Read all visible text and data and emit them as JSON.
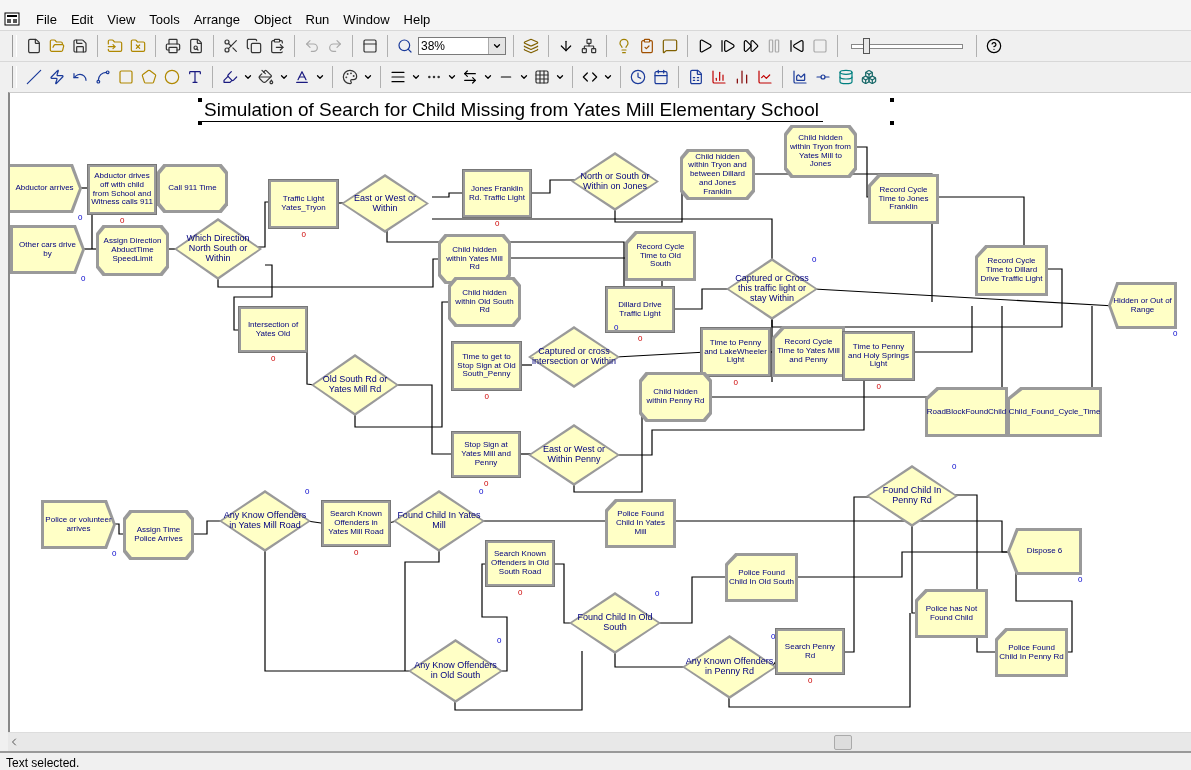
{
  "menu": [
    "File",
    "Edit",
    "View",
    "Tools",
    "Arrange",
    "Object",
    "Run",
    "Window",
    "Help"
  ],
  "zoom": {
    "value": "38%"
  },
  "speed_slider": {
    "level": 0.1
  },
  "diagram": {
    "title": "Simulation of Search for Child Missing from Yates Mill Elementary School",
    "nodes": [
      {
        "kind": "create",
        "label": "Abductor arrives",
        "counter": "0"
      },
      {
        "kind": "process",
        "label": "Abductor drives off with child from School and Witness calls 911",
        "counter": "0"
      },
      {
        "kind": "assign",
        "label": "Call 911 Time"
      },
      {
        "kind": "create",
        "label": "Other cars drive by",
        "counter": "0"
      },
      {
        "kind": "assign",
        "label": "Assign Direction AbductTime SpeedLimit"
      },
      {
        "kind": "decide",
        "label": "Which Direction North South or Within"
      },
      {
        "kind": "process",
        "label": "Traffic Light Yates_Tryon",
        "counter": "0"
      },
      {
        "kind": "decide",
        "label": "East or West or Within"
      },
      {
        "kind": "process",
        "label": "Jones Franklin Rd. Traffic Light",
        "counter": "0"
      },
      {
        "kind": "decide",
        "label": "North or South or Within on Jones"
      },
      {
        "kind": "assign",
        "label": "Child hidden within Tryon and between Dillard and Jones Franklin"
      },
      {
        "kind": "assign",
        "label": "Child hidden within Tryon from Yates Mill to Jones"
      },
      {
        "kind": "record",
        "label": "Record Cycle Time to Jones Franklin"
      },
      {
        "kind": "assign",
        "label": "Child hidden within Yates Mill Rd"
      },
      {
        "kind": "record",
        "label": "Record Cycle Time to Old South"
      },
      {
        "kind": "assign",
        "label": "Child hidden within Old South Rd"
      },
      {
        "kind": "process",
        "label": "Dillard Drive Traffic Light",
        "counter": "0"
      },
      {
        "kind": "decide",
        "label": "Captured or Cross this traffic light or stay Within",
        "counter": "0"
      },
      {
        "kind": "record",
        "label": "Record Cycle Time to Dillard Drive Traffic Light"
      },
      {
        "kind": "dispose",
        "label": "Hidden or Out of Range",
        "counter": "0"
      },
      {
        "kind": "process",
        "label": "Intersection of Yates Old",
        "counter": "0"
      },
      {
        "kind": "decide",
        "label": "Old South Rd or Yates Mill Rd"
      },
      {
        "kind": "process",
        "label": "Time to get to Stop Sign at Old South_Penny",
        "counter": "0"
      },
      {
        "kind": "decide",
        "label": "Captured or cross intersection or Within",
        "counter": "0"
      },
      {
        "kind": "process",
        "label": "Time to Penny and LakeWheeler Light",
        "counter": "0"
      },
      {
        "kind": "record",
        "label": "Record Cycle Time to Yates Mill and Penny"
      },
      {
        "kind": "process",
        "label": "Time to Penny and Holy Springs Light",
        "counter": "0"
      },
      {
        "kind": "assign",
        "label": "Child hidden within Penny Rd"
      },
      {
        "kind": "record",
        "label": "RoadBlockFoundChild"
      },
      {
        "kind": "record",
        "label": "Child_Found_Cycle_Time"
      },
      {
        "kind": "process",
        "label": "Stop Sign at Yates Mill and Penny",
        "counter": "0"
      },
      {
        "kind": "decide",
        "label": "East or West or Within Penny"
      },
      {
        "kind": "create",
        "label": "Police or volunteer arrives",
        "counter": "0"
      },
      {
        "kind": "assign",
        "label": "Assign Time Police Arrives"
      },
      {
        "kind": "decide",
        "label": "Any Know Offenders in Yates Mill Road",
        "counter": "0"
      },
      {
        "kind": "process",
        "label": "Search Known Offenders in Yates Mill Road",
        "counter": "0"
      },
      {
        "kind": "decide",
        "label": "Found Child In Yates Mill",
        "counter": "0"
      },
      {
        "kind": "record",
        "label": "Police Found Child In Yates Mill"
      },
      {
        "kind": "process",
        "label": "Search Known Offenders in Old South Road",
        "counter": "0"
      },
      {
        "kind": "decide",
        "label": "Found Child In Old South",
        "counter": "0"
      },
      {
        "kind": "record",
        "label": "Police Found Child In Old South"
      },
      {
        "kind": "decide",
        "label": "Found Child In Penny Rd",
        "counter": "0"
      },
      {
        "kind": "dispose",
        "label": "Dispose 6",
        "counter": "0"
      },
      {
        "kind": "record",
        "label": "Police has Not Found Child"
      },
      {
        "kind": "decide",
        "label": "Any Known Offenders in Penny Rd",
        "counter": "0"
      },
      {
        "kind": "process",
        "label": "Search Penny Rd",
        "counter": "0"
      },
      {
        "kind": "record",
        "label": "Police Found Child In Penny Rd"
      },
      {
        "kind": "decide",
        "label": "Any Know Offenders in Old South",
        "counter": "0"
      }
    ]
  },
  "status_bar": "Text selected."
}
